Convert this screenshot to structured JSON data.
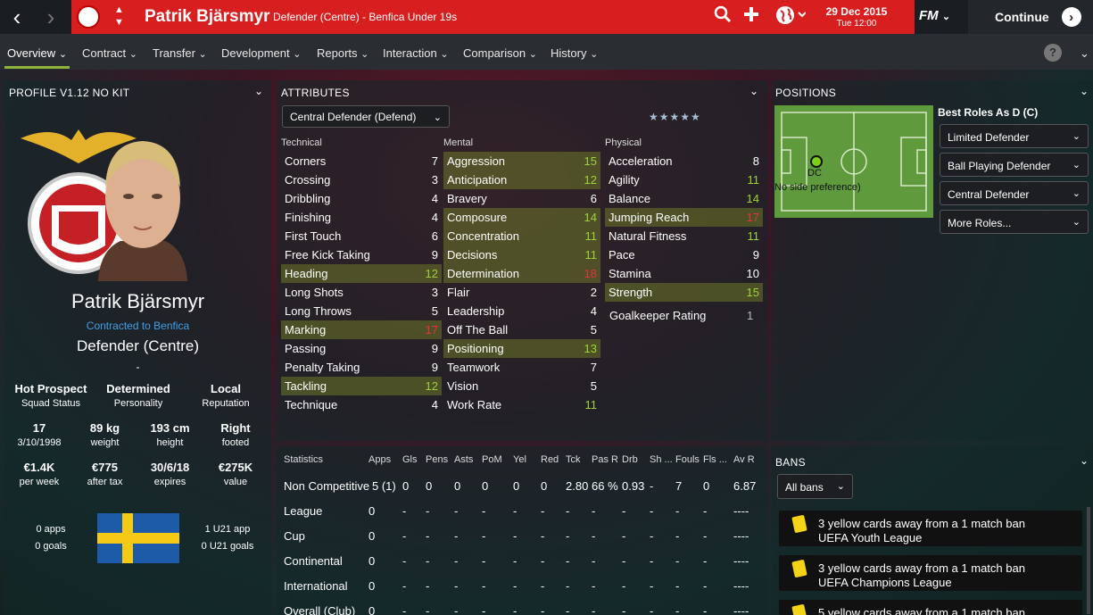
{
  "header": {
    "player_name": "Patrik Bjärsmyr",
    "subtitle": "Defender (Centre) - Benfica Under 19s",
    "date": "29 Dec 2015",
    "time": "Tue 12:00",
    "fm_label": "FM",
    "continue_label": "Continue"
  },
  "tabs": [
    {
      "label": "Overview"
    },
    {
      "label": "Contract"
    },
    {
      "label": "Transfer"
    },
    {
      "label": "Development"
    },
    {
      "label": "Reports"
    },
    {
      "label": "Interaction"
    },
    {
      "label": "Comparison"
    },
    {
      "label": "History"
    }
  ],
  "profile": {
    "title": "PROFILE V1.12 NO KIT",
    "name": "Patrik Bjärsmyr",
    "contract": "Contracted to Benfica",
    "position": "Defender (Centre)",
    "dash": "-",
    "info": [
      {
        "value": "Hot Prospect",
        "label": "Squad Status"
      },
      {
        "value": "Determined",
        "label": "Personality"
      },
      {
        "value": "Local",
        "label": "Reputation"
      },
      {
        "value": "17",
        "label": "3/10/1998"
      },
      {
        "value": "89 kg",
        "label": "weight"
      },
      {
        "value": "193 cm",
        "label": "height"
      },
      {
        "value": "Right",
        "label": "footed"
      },
      {
        "value": "€1.4K",
        "label": "per week"
      },
      {
        "value": "€775",
        "label": "after tax"
      },
      {
        "value": "30/6/18",
        "label": "expires"
      },
      {
        "value": "€275K",
        "label": "value"
      }
    ],
    "apps": "0 apps",
    "goals": "0 goals",
    "u21_apps": "1 U21 app",
    "u21_goals": "0 U21 goals"
  },
  "attributes": {
    "title": "ATTRIBUTES",
    "role": "Central Defender (Defend)",
    "stars": "★★★★★",
    "technical_label": "Technical",
    "mental_label": "Mental",
    "physical_label": "Physical",
    "technical": [
      {
        "n": "Corners",
        "v": "7"
      },
      {
        "n": "Crossing",
        "v": "3"
      },
      {
        "n": "Dribbling",
        "v": "4"
      },
      {
        "n": "Finishing",
        "v": "4"
      },
      {
        "n": "First Touch",
        "v": "6"
      },
      {
        "n": "Free Kick Taking",
        "v": "9"
      },
      {
        "n": "Heading",
        "v": "12"
      },
      {
        "n": "Long Shots",
        "v": "3"
      },
      {
        "n": "Long Throws",
        "v": "5"
      },
      {
        "n": "Marking",
        "v": "17"
      },
      {
        "n": "Passing",
        "v": "9"
      },
      {
        "n": "Penalty Taking",
        "v": "9"
      },
      {
        "n": "Tackling",
        "v": "12"
      },
      {
        "n": "Technique",
        "v": "4"
      }
    ],
    "mental": [
      {
        "n": "Aggression",
        "v": "15"
      },
      {
        "n": "Anticipation",
        "v": "12"
      },
      {
        "n": "Bravery",
        "v": "6"
      },
      {
        "n": "Composure",
        "v": "14"
      },
      {
        "n": "Concentration",
        "v": "11"
      },
      {
        "n": "Decisions",
        "v": "11"
      },
      {
        "n": "Determination",
        "v": "18"
      },
      {
        "n": "Flair",
        "v": "2"
      },
      {
        "n": "Leadership",
        "v": "4"
      },
      {
        "n": "Off The Ball",
        "v": "5"
      },
      {
        "n": "Positioning",
        "v": "13"
      },
      {
        "n": "Teamwork",
        "v": "7"
      },
      {
        "n": "Vision",
        "v": "5"
      },
      {
        "n": "Work Rate",
        "v": "11"
      }
    ],
    "physical": [
      {
        "n": "Acceleration",
        "v": "8"
      },
      {
        "n": "Agility",
        "v": "11"
      },
      {
        "n": "Balance",
        "v": "14"
      },
      {
        "n": "Jumping Reach",
        "v": "17"
      },
      {
        "n": "Natural Fitness",
        "v": "11"
      },
      {
        "n": "Pace",
        "v": "9"
      },
      {
        "n": "Stamina",
        "v": "10"
      },
      {
        "n": "Strength",
        "v": "15"
      }
    ],
    "gk_label": "Goalkeeper Rating",
    "gk_value": "1"
  },
  "positions": {
    "title": "POSITIONS",
    "pos_label": "DC",
    "pref": "No side preference)",
    "best_roles_title": "Best Roles As D (C)",
    "roles": [
      "Limited Defender",
      "Ball Playing Defender",
      "Central Defender",
      "More Roles..."
    ]
  },
  "stats": {
    "headers": [
      "Statistics",
      "Apps",
      "Gls",
      "Pens",
      "Asts",
      "PoM",
      "Yel",
      "Red",
      "Tck",
      "Pas R",
      "Drb",
      "Sh ...",
      "Fouls",
      "Fls ...",
      "Av R"
    ],
    "rows": [
      [
        "Non Competitive",
        "5 (1)",
        "0",
        "0",
        "0",
        "0",
        "0",
        "0",
        "2.80",
        "66 %",
        "0.93",
        "-",
        "7",
        "0",
        "6.87"
      ],
      [
        "League",
        "0",
        "-",
        "-",
        "-",
        "-",
        "-",
        "-",
        "-",
        "-",
        "-",
        "-",
        "-",
        "-",
        "----"
      ],
      [
        "Cup",
        "0",
        "-",
        "-",
        "-",
        "-",
        "-",
        "-",
        "-",
        "-",
        "-",
        "-",
        "-",
        "-",
        "----"
      ],
      [
        "Continental",
        "0",
        "-",
        "-",
        "-",
        "-",
        "-",
        "-",
        "-",
        "-",
        "-",
        "-",
        "-",
        "-",
        "----"
      ],
      [
        "International",
        "0",
        "-",
        "-",
        "-",
        "-",
        "-",
        "-",
        "-",
        "-",
        "-",
        "-",
        "-",
        "-",
        "----"
      ],
      [
        "Overall (Club)",
        "0",
        "-",
        "-",
        "-",
        "-",
        "-",
        "-",
        "-",
        "-",
        "-",
        "-",
        "-",
        "-",
        "----"
      ]
    ]
  },
  "bans": {
    "title": "BANS",
    "filter": "All bans",
    "items": [
      {
        "title": "3 yellow cards away from a 1 match ban",
        "sub": "UEFA Youth League"
      },
      {
        "title": "3 yellow cards away from a 1 match ban",
        "sub": "UEFA Champions League"
      },
      {
        "title": "5 yellow cards away from a 1 match ban",
        "sub": ""
      }
    ]
  },
  "colors": {
    "accent_red": "#d81f1f",
    "highlight_green": "#9fd23c",
    "high_red": "#e8323a"
  }
}
